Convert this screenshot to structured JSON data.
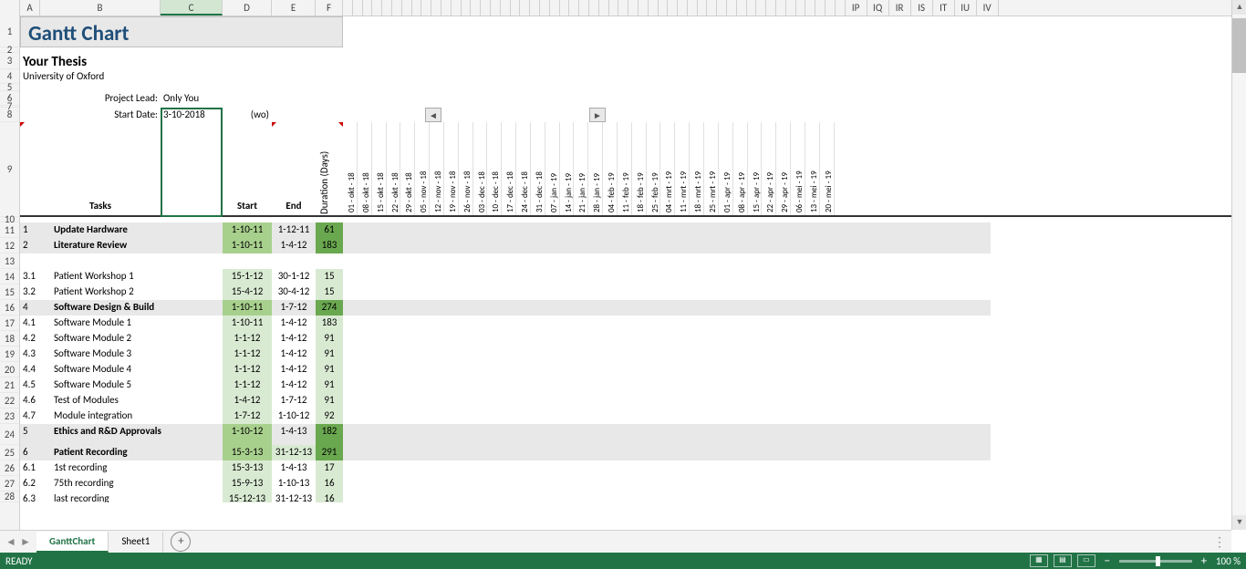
{
  "columns": {
    "A": 22,
    "B": 132,
    "C": 68,
    "D": 54,
    "E": 48,
    "F": 30
  },
  "narrow_width": 18,
  "end_cols": [
    "IP",
    "IQ",
    "IR",
    "IS",
    "IT",
    "IU",
    "IV"
  ],
  "title": "Gantt Chart",
  "thesis": "Your Thesis",
  "university": "University of Oxford",
  "project_lead_label": "Project Lead:",
  "project_lead": "Only You",
  "start_date_label": "Start Date:",
  "start_date": "3-10-2018",
  "start_date_wo": "(wo)",
  "headers": {
    "tasks": "Tasks",
    "start": "Start",
    "end": "End",
    "duration": "Duration (Days)"
  },
  "dates": [
    "01 - okt - 18",
    "08 - okt - 18",
    "15 - okt - 18",
    "22 - okt - 18",
    "29 - okt - 18",
    "05 - nov - 18",
    "12 - nov - 18",
    "19 - nov - 18",
    "26 - nov - 18",
    "03 - dec - 18",
    "10 - dec - 18",
    "17 - dec - 18",
    "24 - dec - 18",
    "31 - dec - 18",
    "07 - jan - 19",
    "14 - jan - 19",
    "21 - jan - 19",
    "28 - jan - 19",
    "04 - feb - 19",
    "11 - feb - 19",
    "18 - feb - 19",
    "25 - feb - 19",
    "04 - mrt - 19",
    "11 - mrt - 19",
    "18 - mrt - 19",
    "25 - mrt - 19",
    "01 - apr - 19",
    "08 - apr - 19",
    "15 - apr - 19",
    "22 - apr - 19",
    "29 - apr - 19",
    "06 - mei - 19",
    "13 - mei - 19",
    "20 - mei - 19"
  ],
  "tasks": [
    {
      "r": 11,
      "id": "1",
      "name": "Update Hardware",
      "start": "1-10-11",
      "end": "1-12-11",
      "dur": "61",
      "bold": true,
      "gray": true,
      "start_bg": "green",
      "end_bg": "",
      "dur_bg": "dgreen"
    },
    {
      "r": 12,
      "id": "2",
      "name": "Literature Review",
      "start": "1-10-11",
      "end": "1-4-12",
      "dur": "183",
      "bold": true,
      "gray": true,
      "start_bg": "green",
      "end_bg": "",
      "dur_bg": "dgreen"
    },
    {
      "r": 14,
      "id": "3.1",
      "name": "Patient Workshop 1",
      "start": "15-1-12",
      "end": "30-1-12",
      "dur": "15",
      "bold": false,
      "gray": false,
      "start_bg": "lgreen",
      "end_bg": "",
      "dur_bg": "lgreen"
    },
    {
      "r": 15,
      "id": "3.2",
      "name": "Patient Workshop 2",
      "start": "15-4-12",
      "end": "30-4-12",
      "dur": "15",
      "bold": false,
      "gray": false,
      "start_bg": "lgreen",
      "end_bg": "",
      "dur_bg": "lgreen"
    },
    {
      "r": 16,
      "id": "4",
      "name": "Software Design & Build",
      "start": "1-10-11",
      "end": "1-7-12",
      "dur": "274",
      "bold": true,
      "gray": true,
      "start_bg": "green",
      "end_bg": "",
      "dur_bg": "dgreen"
    },
    {
      "r": 17,
      "id": "4.1",
      "name": "Software Module 1",
      "start": "1-10-11",
      "end": "1-4-12",
      "dur": "183",
      "bold": false,
      "gray": false,
      "start_bg": "lgreen",
      "end_bg": "",
      "dur_bg": "lgreen"
    },
    {
      "r": 18,
      "id": "4.2",
      "name": "Software Module 2",
      "start": "1-1-12",
      "end": "1-4-12",
      "dur": "91",
      "bold": false,
      "gray": false,
      "start_bg": "lgreen",
      "end_bg": "",
      "dur_bg": "lgreen"
    },
    {
      "r": 19,
      "id": "4.3",
      "name": "Software Module 3",
      "start": "1-1-12",
      "end": "1-4-12",
      "dur": "91",
      "bold": false,
      "gray": false,
      "start_bg": "lgreen",
      "end_bg": "",
      "dur_bg": "lgreen"
    },
    {
      "r": 20,
      "id": "4.4",
      "name": "Software Module 4",
      "start": "1-1-12",
      "end": "1-4-12",
      "dur": "91",
      "bold": false,
      "gray": false,
      "start_bg": "lgreen",
      "end_bg": "",
      "dur_bg": "lgreen"
    },
    {
      "r": 21,
      "id": "4.5",
      "name": "Software Module 5",
      "start": "1-1-12",
      "end": "1-4-12",
      "dur": "91",
      "bold": false,
      "gray": false,
      "start_bg": "lgreen",
      "end_bg": "",
      "dur_bg": "lgreen"
    },
    {
      "r": 22,
      "id": "4.6",
      "name": "Test of Modules",
      "start": "1-4-12",
      "end": "1-7-12",
      "dur": "91",
      "bold": false,
      "gray": false,
      "start_bg": "lgreen",
      "end_bg": "",
      "dur_bg": "lgreen"
    },
    {
      "r": 23,
      "id": "4.7",
      "name": "Module integration",
      "start": "1-7-12",
      "end": "1-10-12",
      "dur": "92",
      "bold": false,
      "gray": false,
      "start_bg": "lgreen",
      "end_bg": "",
      "dur_bg": "lgreen"
    },
    {
      "r": 24,
      "id": "5",
      "name": "Ethics and R&D Approvals",
      "start": "1-10-12",
      "end": "1-4-13",
      "dur": "182",
      "bold": true,
      "gray": true,
      "start_bg": "green",
      "end_bg": "",
      "dur_bg": "dgreen",
      "tall": true
    },
    {
      "r": 25,
      "id": "6",
      "name": "Patient Recording",
      "start": "15-3-13",
      "end": "31-12-13",
      "dur": "291",
      "bold": true,
      "gray": true,
      "start_bg": "green",
      "end_bg": "lgreen",
      "dur_bg": "dgreen"
    },
    {
      "r": 26,
      "id": "6.1",
      "name": "1st  recording",
      "start": "15-3-13",
      "end": "1-4-13",
      "dur": "17",
      "bold": false,
      "gray": false,
      "start_bg": "lgreen",
      "end_bg": "",
      "dur_bg": "lgreen"
    },
    {
      "r": 27,
      "id": "6.2",
      "name": "75th recording",
      "start": "15-9-13",
      "end": "1-10-13",
      "dur": "16",
      "bold": false,
      "gray": false,
      "start_bg": "lgreen",
      "end_bg": "",
      "dur_bg": "lgreen"
    },
    {
      "r": 28,
      "id": "6.3",
      "name": "last recording",
      "start": "15-12-13",
      "end": "31-12-13",
      "dur": "16",
      "bold": false,
      "gray": false,
      "start_bg": "lgreen",
      "end_bg": "",
      "dur_bg": "lgreen"
    }
  ],
  "tabs": [
    "GanttChart",
    "Sheet1"
  ],
  "active_tab": 0,
  "status": "READY",
  "zoom": "100 %",
  "selected_col": "C"
}
